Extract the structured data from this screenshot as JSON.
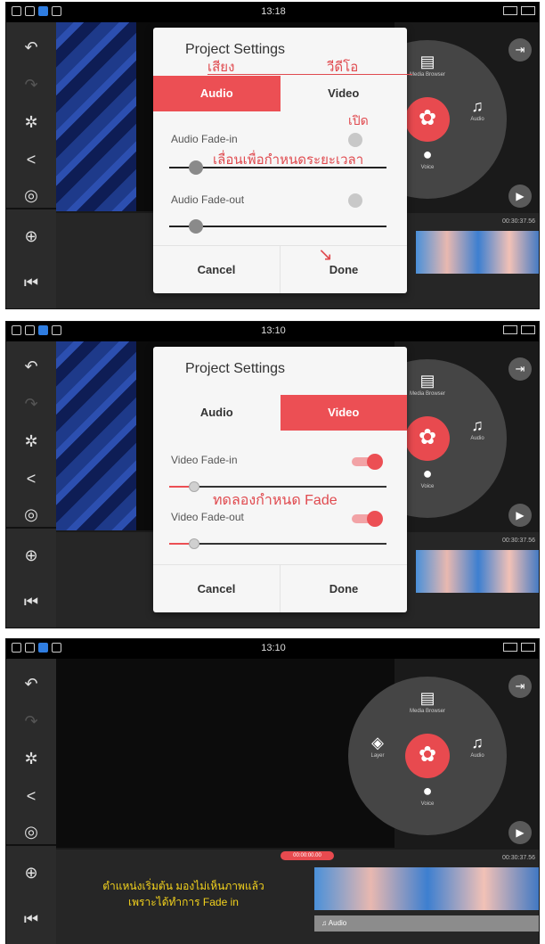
{
  "status_bar": {
    "time1": "13:18",
    "time2": "13:10",
    "time3": "13:10"
  },
  "timeline": {
    "time_display": "00:30:37.56",
    "audio_track_label": "Audio",
    "playhead_time": "00:00:00.00"
  },
  "wheel": {
    "media_browser": "Media Browser",
    "layer": "Layer",
    "audio": "Audio",
    "voice": "Voice"
  },
  "dialog": {
    "title": "Project Settings",
    "tab_audio": "Audio",
    "tab_video": "Video",
    "audio_fade_in": "Audio Fade-in",
    "audio_fade_out": "Audio Fade-out",
    "video_fade_in": "Video Fade-in",
    "video_fade_out": "Video Fade-out",
    "cancel": "Cancel",
    "done": "Done"
  },
  "annotations": {
    "sound": "เสียง",
    "video": "วีดีโอ",
    "open": "เปิด",
    "slide_to_set_duration": "เลื่อนเพื่อกำหนดระยะเวลา",
    "try_set_fade": "ทดลองกำหนด Fade",
    "note_line1": "ตำแหน่งเริ่มต้น มองไม่เห็นภาพแล้ว",
    "note_line2": "เพราะได้ทำการ Fade in"
  },
  "colors": {
    "accent": "#ec4f54",
    "annotation": "#e04a4f",
    "note": "#f3d21d"
  }
}
